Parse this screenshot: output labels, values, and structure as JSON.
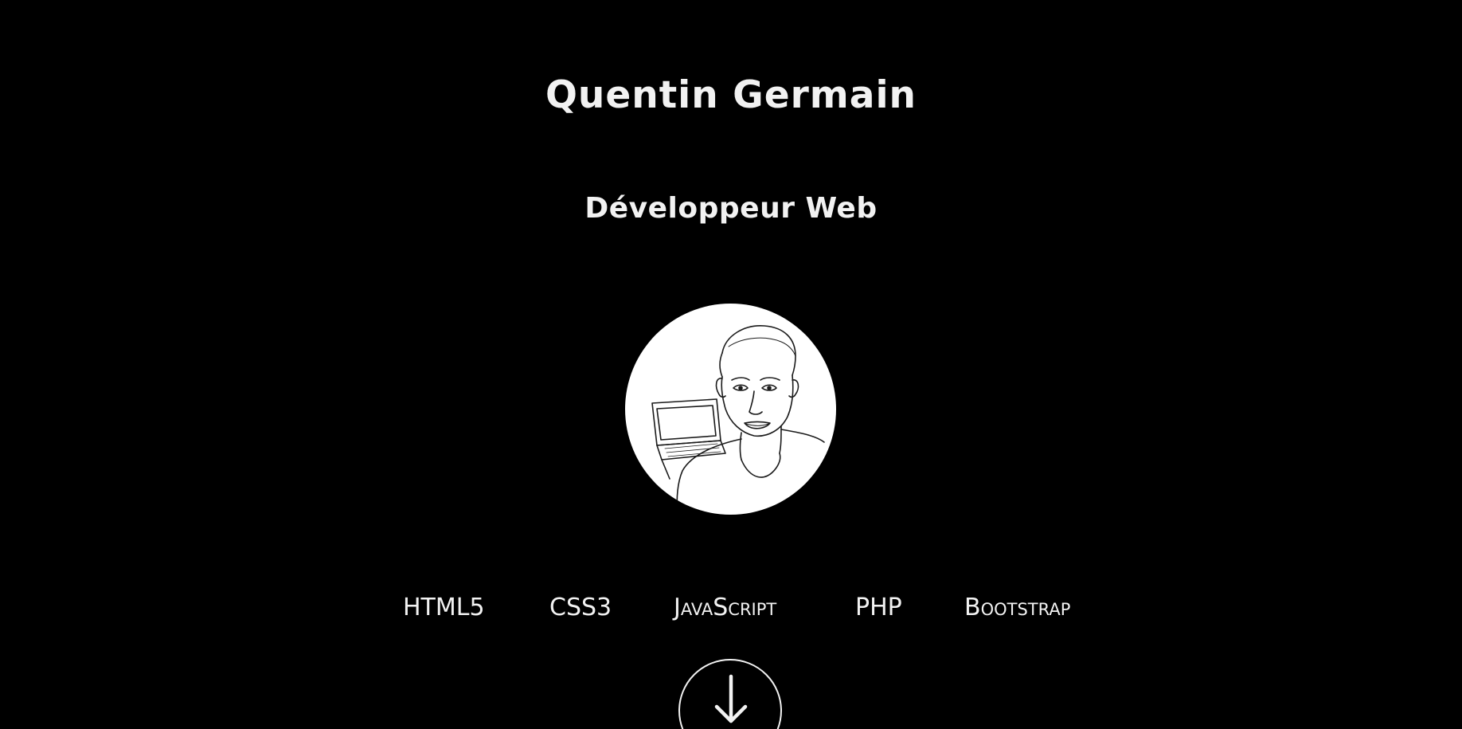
{
  "header": {
    "name": "Quentin Germain",
    "role": "Développeur Web"
  },
  "avatar": {
    "icon": "developer-portrait-drawing"
  },
  "skills": [
    {
      "label": "HTML5"
    },
    {
      "label": "CSS3"
    },
    {
      "label": "JavaScript"
    },
    {
      "label": "PHP"
    },
    {
      "label": "Bootstrap"
    }
  ],
  "scroll_button": {
    "icon": "arrow-down-icon"
  },
  "colors": {
    "background": "#000000",
    "text": "#f2f2f2",
    "avatar_bg": "#ffffff"
  }
}
